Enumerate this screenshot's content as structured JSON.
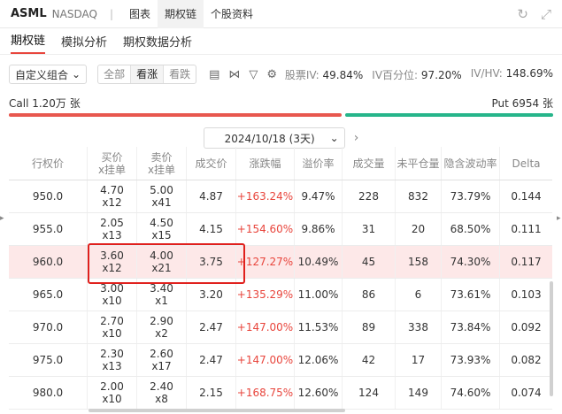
{
  "header": {
    "symbol": "ASML",
    "exchange": "NASDAQ",
    "separator": "|",
    "tabs": [
      {
        "label": "图表"
      },
      {
        "label": "期权链"
      },
      {
        "label": "个股资料"
      }
    ],
    "icons": [
      "refresh-icon",
      "expand-icon"
    ]
  },
  "subtabs": [
    {
      "label": "期权链"
    },
    {
      "label": "模拟分析"
    },
    {
      "label": "期权数据分析"
    }
  ],
  "toolbar": {
    "combo_label": "自定义组合",
    "segments": [
      {
        "label": "全部"
      },
      {
        "label": "看涨"
      },
      {
        "label": "看跌"
      }
    ],
    "stats": {
      "iv_label": "股票IV:",
      "iv_value": "49.84%",
      "ivp_label": "IV百分位:",
      "ivp_value": "97.20%",
      "ivhv_label": "IV/HV:",
      "ivhv_value": "148.69%"
    }
  },
  "callput": {
    "call_label": "Call 1.20万 张",
    "put_label": "Put 6954 张"
  },
  "date_selector": {
    "value": "2024/10/18 (3天)"
  },
  "table": {
    "headers": [
      "行权价",
      "买价",
      "x挂单",
      "卖价",
      "x挂单",
      "成交价",
      "涨跌幅",
      "溢价率",
      "成交量",
      "未平仓量",
      "隐含波动率",
      "Delta"
    ],
    "rows": [
      {
        "strike": "950.0",
        "bid": "4.70",
        "bid_size": "x12",
        "ask": "5.00",
        "ask_size": "x41",
        "last": "4.87",
        "change": "+163.24%",
        "premium": "9.47%",
        "volume": "228",
        "oi": "832",
        "iv": "73.79%",
        "delta": "0.144"
      },
      {
        "strike": "955.0",
        "bid": "2.05",
        "bid_size": "x13",
        "ask": "4.50",
        "ask_size": "x15",
        "last": "4.15",
        "change": "+154.60%",
        "premium": "9.86%",
        "volume": "31",
        "oi": "20",
        "iv": "68.50%",
        "delta": "0.111"
      },
      {
        "strike": "960.0",
        "bid": "3.60",
        "bid_size": "x12",
        "ask": "4.00",
        "ask_size": "x21",
        "last": "3.75",
        "change": "+127.27%",
        "premium": "10.49%",
        "volume": "45",
        "oi": "158",
        "iv": "74.30%",
        "delta": "0.117"
      },
      {
        "strike": "965.0",
        "bid": "3.00",
        "bid_size": "x10",
        "ask": "3.40",
        "ask_size": "x1",
        "last": "3.20",
        "change": "+135.29%",
        "premium": "11.00%",
        "volume": "86",
        "oi": "6",
        "iv": "73.61%",
        "delta": "0.103"
      },
      {
        "strike": "970.0",
        "bid": "2.70",
        "bid_size": "x10",
        "ask": "2.90",
        "ask_size": "x2",
        "last": "2.47",
        "change": "+147.00%",
        "premium": "11.53%",
        "volume": "89",
        "oi": "338",
        "iv": "73.84%",
        "delta": "0.092"
      },
      {
        "strike": "975.0",
        "bid": "2.30",
        "bid_size": "x13",
        "ask": "2.60",
        "ask_size": "x17",
        "last": "2.47",
        "change": "+147.00%",
        "premium": "12.06%",
        "volume": "42",
        "oi": "17",
        "iv": "73.93%",
        "delta": "0.082"
      },
      {
        "strike": "980.0",
        "bid": "2.00",
        "bid_size": "x10",
        "ask": "2.40",
        "ask_size": "x8",
        "last": "2.15",
        "change": "+168.75%",
        "premium": "12.60%",
        "volume": "124",
        "oi": "149",
        "iv": "74.60%",
        "delta": "0.074"
      }
    ]
  },
  "colors": {
    "accent_red": "#e8453c",
    "call_bar": "#e8574e",
    "put_bar": "#26b58a",
    "highlight_row": "#fde8e8",
    "selection_box": "#e0201d"
  }
}
